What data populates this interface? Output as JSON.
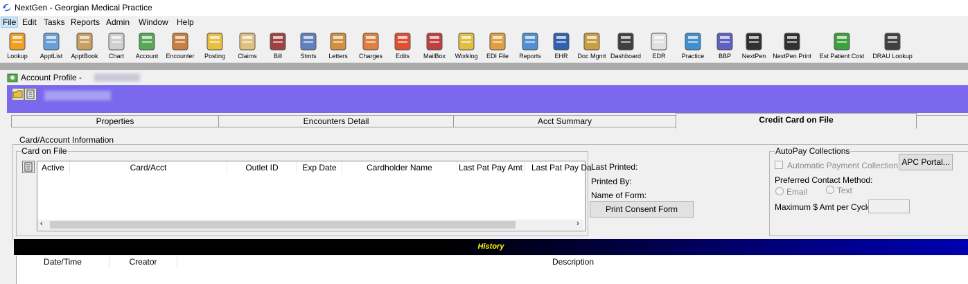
{
  "app": {
    "title": "NextGen - Georgian Medical Practice"
  },
  "menu": [
    "File",
    "Edit",
    "Tasks",
    "Reports",
    "Admin",
    "Window",
    "Help"
  ],
  "toolbar": [
    {
      "label": "Lookup",
      "icon": "lookup-icon",
      "color": "#f0a020"
    },
    {
      "label": "ApptList",
      "icon": "appt-list-icon",
      "color": "#6aa0d8"
    },
    {
      "label": "ApptBook",
      "icon": "appt-book-icon",
      "color": "#c8a060"
    },
    {
      "label": "Chart",
      "icon": "chart-icon",
      "color": "#d0d0d0"
    },
    {
      "label": "Account",
      "icon": "account-icon",
      "color": "#58a858"
    },
    {
      "label": "Encounter",
      "icon": "encounter-icon",
      "color": "#c88040"
    },
    {
      "label": "Posting",
      "icon": "posting-icon",
      "color": "#e8c040"
    },
    {
      "label": "Claims",
      "icon": "claims-icon",
      "color": "#e0c080"
    },
    {
      "label": "Bill",
      "icon": "bill-icon",
      "color": "#a04040"
    },
    {
      "label": "Stmts",
      "icon": "statements-icon",
      "color": "#6080c0"
    },
    {
      "label": "Letters",
      "icon": "letters-icon",
      "color": "#d09040"
    },
    {
      "label": "Charges",
      "icon": "charges-icon",
      "color": "#e08040"
    },
    {
      "label": "Edits",
      "icon": "edits-icon",
      "color": "#e05030"
    },
    {
      "label": "MailBox",
      "icon": "mailbox-icon",
      "color": "#c04040"
    },
    {
      "label": "Worklog",
      "icon": "worklog-icon",
      "color": "#e0c040"
    },
    {
      "label": "EDI File",
      "icon": "edi-file-icon",
      "color": "#e0a040"
    },
    {
      "label": "Reports",
      "icon": "reports-icon",
      "color": "#5090d0"
    },
    {
      "label": "EHR",
      "icon": "ehr-icon",
      "color": "#3060b0"
    },
    {
      "label": "Doc Mgmt",
      "icon": "doc-mgmt-icon",
      "color": "#c8a040"
    },
    {
      "label": "Dashboard",
      "icon": "dashboard-icon",
      "color": "#404040"
    },
    {
      "label": "EDR",
      "icon": "edr-icon",
      "color": "#e0e0e0"
    },
    {
      "label": "Practice",
      "icon": "practice-icon",
      "color": "#4090d0"
    },
    {
      "label": "BBP",
      "icon": "bbp-icon",
      "color": "#6060c0"
    },
    {
      "label": "NextPen",
      "icon": "nextpen-icon",
      "color": "#303030"
    },
    {
      "label": "NextPen Print",
      "icon": "nextpen-print-icon",
      "color": "#303030"
    },
    {
      "label": "Est Patient Cost",
      "icon": "est-patient-cost-icon",
      "color": "#40a040"
    },
    {
      "label": "DRAU Lookup",
      "icon": "drau-lookup-icon",
      "color": "#404040"
    }
  ],
  "window": {
    "title": "Account Profile -"
  },
  "tabs": [
    "Properties",
    "Encounters Detail",
    "Acct Summary",
    "Credit Card on File"
  ],
  "section": {
    "title": "Card/Account Information"
  },
  "card_on_file": {
    "legend": "Card on File",
    "columns": [
      "Active",
      "Card/Acct",
      "Outlet ID",
      "Exp Date",
      "Cardholder Name",
      "Last Pat Pay Amt",
      "Last Pat Pay Da"
    ]
  },
  "print_info": {
    "last_printed": "Last Printed:",
    "printed_by": "Printed By:",
    "name_of_form": "Name of Form:",
    "print_button": "Print Consent Form"
  },
  "autopay": {
    "legend": "AutoPay Collections",
    "auto_collection": "Automatic Payment Collection",
    "apc_button": "APC Portal...",
    "preferred_contact": "Preferred Contact Method:",
    "email": "Email",
    "text": "Text",
    "max_amount": "Maximum $ Amt per Cycle:"
  },
  "history": {
    "title": "History",
    "columns": [
      "Date/Time",
      "Creator",
      "Description"
    ]
  }
}
